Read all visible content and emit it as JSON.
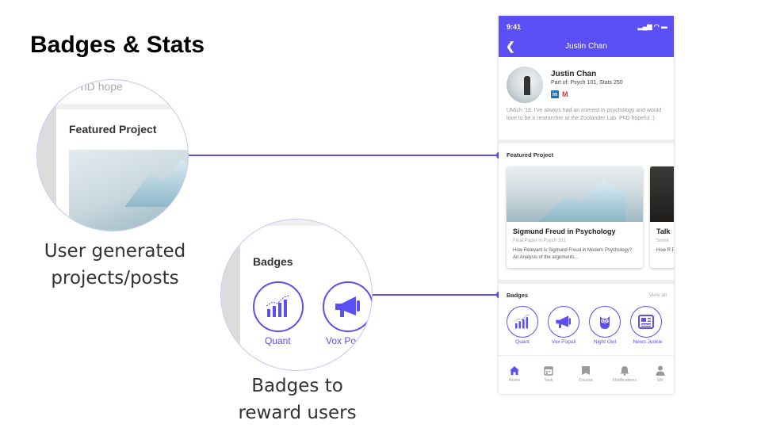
{
  "slide": {
    "title": "Badges & Stats",
    "caption_projects": "User generated projects/posts",
    "caption_badges": "Badges to reward users"
  },
  "zoom_projects": {
    "top_text": "b. PhD hope",
    "title": "Featured Project"
  },
  "zoom_badges": {
    "title": "Badges",
    "badge1": "Quant",
    "badge2": "Vox Po"
  },
  "phone": {
    "status_time": "9:41",
    "status_icons": "▂▄▆ ◠ ▬",
    "header_title": "Justin Chan",
    "profile": {
      "name": "Justin Chan",
      "part_of": "Part of: Psych 101, Stats 250",
      "linkedin": "in",
      "gmail": "M",
      "bio": "UMich '18. I've always had an interest in psychology and would love to be a researcher at the Zoolander Lab. PhD hopeful :)"
    },
    "featured": {
      "title": "Featured Project",
      "cards": [
        {
          "title": "Sigmund Freud in Psychology",
          "subtitle": "Final Paper in Psych 101",
          "description": "How Relevant is Sigmund Freud in Modern Psychology? An Analysis of the arguments..."
        },
        {
          "title": "Talk",
          "subtitle": "Some",
          "description": "How R Psych"
        }
      ]
    },
    "badges": {
      "title": "Badges",
      "view_all": "View all",
      "items": [
        {
          "label": "Quant",
          "icon": "bar-chart-icon"
        },
        {
          "label": "Vox Populi",
          "icon": "megaphone-icon"
        },
        {
          "label": "Night Owl",
          "icon": "owl-icon"
        },
        {
          "label": "News Junkie",
          "icon": "newspaper-icon"
        }
      ]
    },
    "tabs": [
      {
        "label": "Home",
        "icon": "home-icon"
      },
      {
        "label": "Task",
        "icon": "calendar-icon"
      },
      {
        "label": "Course",
        "icon": "book-icon"
      },
      {
        "label": "Notifications",
        "icon": "bell-icon"
      },
      {
        "label": "Me",
        "icon": "person-icon"
      }
    ]
  },
  "colors": {
    "accent": "#5b4ef5",
    "divider": "#eeeeee",
    "muted_text": "#999999"
  }
}
